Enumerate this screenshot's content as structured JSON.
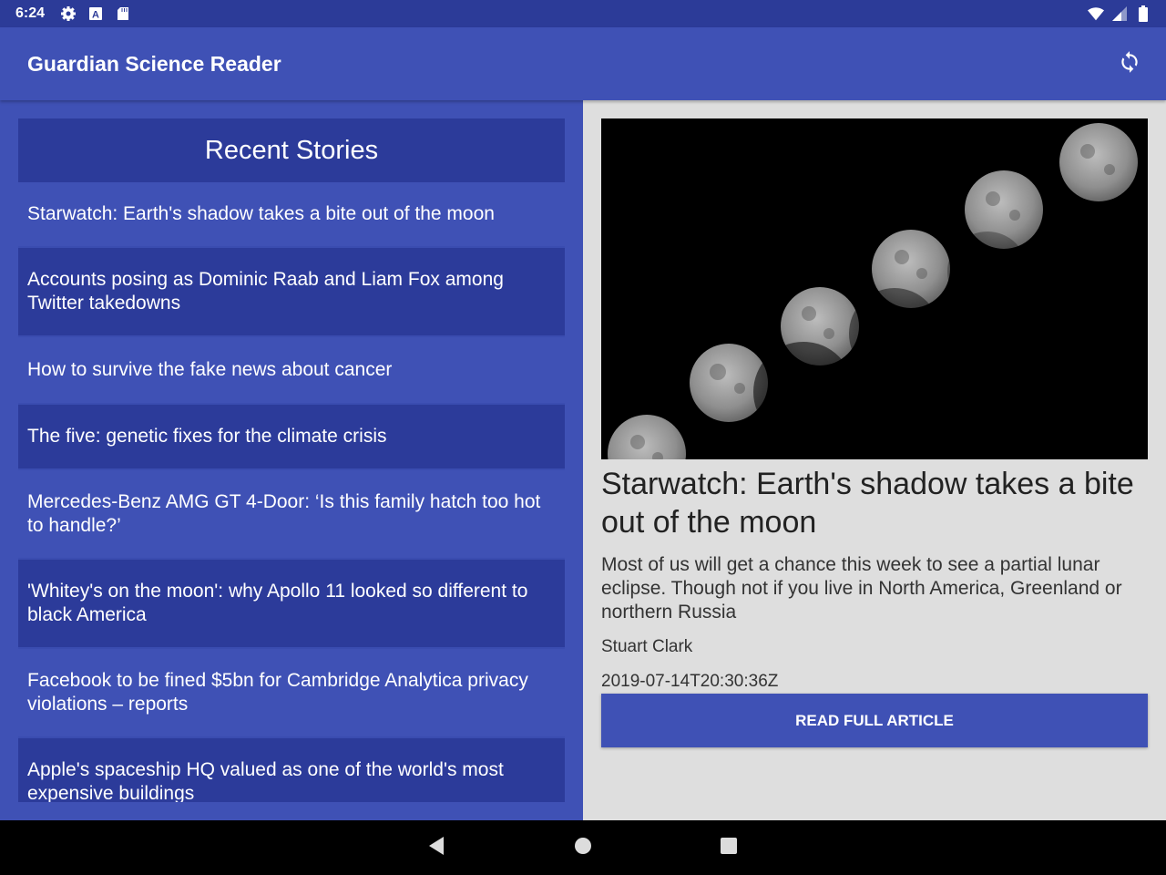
{
  "status_bar": {
    "time": "6:24",
    "left_icons": [
      "gear-icon",
      "a-badge-icon",
      "sd-card-icon"
    ],
    "right_icons": [
      "wifi-icon",
      "cell-signal-icon",
      "battery-icon"
    ]
  },
  "app_bar": {
    "title": "Guardian Science Reader",
    "refresh_icon": "refresh-icon",
    "color": "#3f51b5"
  },
  "left_pane": {
    "header": "Recent Stories",
    "stories": [
      "Starwatch: Earth's shadow takes a bite out of the moon",
      "Accounts posing as Dominic Raab and Liam Fox among Twitter takedowns",
      "How to survive the fake news about cancer",
      "The five: genetic fixes for the climate crisis",
      "Mercedes-Benz AMG GT 4-Door: ‘Is this family hatch too hot to handle?’",
      "'Whitey's on the moon': why Apollo 11 looked so different to black America",
      "Facebook to be fined $5bn for Cambridge Analytica privacy violations – reports",
      "Apple's spaceship HQ valued as one of the world's most expensive buildings"
    ]
  },
  "article": {
    "image": "lunar-eclipse-sequence",
    "title": "Starwatch: Earth's shadow takes a bite out of the moon",
    "summary": "Most of us will get a chance this week to see a partial lunar eclipse. Though not if you live in North America, Greenland or northern Russia",
    "author": "Stuart Clark",
    "date": "2019-07-14T20:30:36Z",
    "read_button": "READ FULL ARTICLE"
  },
  "nav_bar": {
    "buttons": [
      "back-icon",
      "home-icon",
      "recents-icon"
    ]
  }
}
